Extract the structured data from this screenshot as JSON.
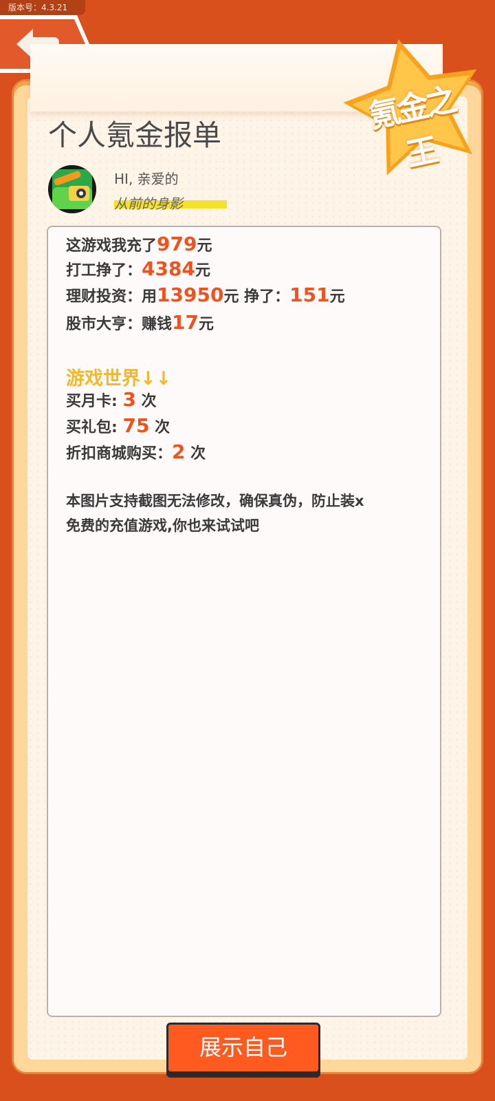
{
  "version_label": "版本号：4.3.21",
  "title": "个人氪金报单",
  "badge_text": "氪金之王",
  "greeting": "HI, 亲爱的",
  "username": "从前的身影",
  "report": {
    "line1": {
      "prefix": "这游戏我充了",
      "value": "979",
      "suffix": "元"
    },
    "line2": {
      "prefix": "打工挣了：",
      "value": "4384",
      "suffix": "元"
    },
    "line3": {
      "prefix": "理财投资：用",
      "value": "13950",
      "mid": "元 挣了：",
      "value2": "151",
      "suffix": "元"
    },
    "line4": {
      "prefix": "股市大亨：赚钱",
      "value": "17",
      "suffix": "元"
    },
    "section_title": "游戏世界↓↓",
    "line5": {
      "prefix": "买月卡: ",
      "value": "3",
      "suffix": " 次"
    },
    "line6": {
      "prefix": "买礼包: ",
      "value": "75",
      "suffix": " 次"
    },
    "line7": {
      "prefix": "折扣商城购买：",
      "value": "2",
      "suffix": " 次"
    },
    "note1": "本图片支持截图无法修改，确保真伪，防止装x",
    "note2": "免费的充值游戏,你也来试试吧"
  },
  "cta_label": "展示自己",
  "colors": {
    "accent": "#f0521e",
    "highlight": "#f3b72a",
    "background": "#d9501c"
  }
}
